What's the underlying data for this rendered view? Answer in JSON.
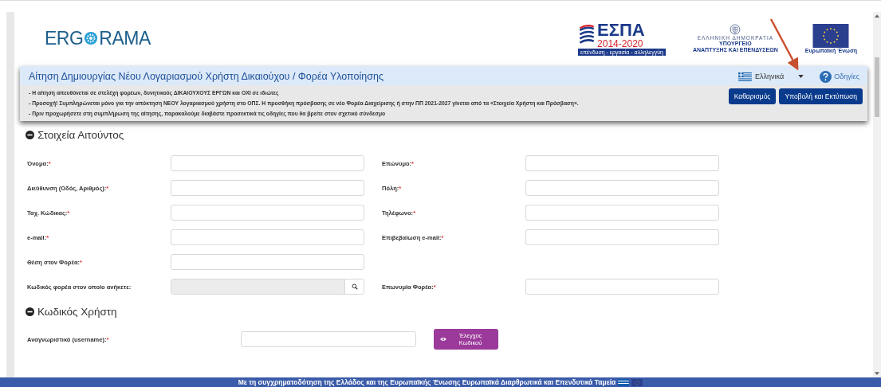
{
  "header": {
    "logo": {
      "before": "ERG",
      "after": "RAMA"
    },
    "espa": {
      "name": "ΕΣΠΑ",
      "years": "2014-2020",
      "motto": "επένδυση - εργασία - αλληλεγγύη"
    },
    "ministry": {
      "state": "ΕΛΛΗΝΙΚΗ ΔΗΜΟΚΡΑΤΙΑ",
      "line1": "ΥΠΟΥΡΓΕΙΟ",
      "line2": "ΑΝΑΠΤΥΞΗΣ ΚΑΙ ΕΠΕΝΔΥΣΕΩΝ"
    },
    "eu": {
      "name": "Ευρωπαϊκή Ένωση"
    }
  },
  "panel": {
    "title": "Αίτηση Δημιουργίας Νέου Λογαριασμού Χρήστη Δικαιούχου / Φορέα Υλοποίησης",
    "language": "Ελληνικά",
    "help": "Οδηγίες",
    "notes": [
      "- Η αίτηση απευθύνεται σε στελέχη φορέων, δυνητικούς ΔΙΚΑΙΟΥΧΟΥΣ ΕΡΓΩΝ και ΟΧΙ σε ιδιώτες",
      "- Προσοχή! Συμπληρώνεται μόνο για την απόκτηση ΝΕΟΥ λογαριασμού χρήστη στο ΟΠΣ. Η προσθήκη πρόσβασης σε νέο Φορέα Διαχείρισης ή στην ΠΠ 2021-2027 γίνεται από τα «Στοιχεία Χρήστη και Πρόσβαση».",
      "- Πριν προχωρήσετε στη συμπλήρωση της αίτησης, παρακαλούμε διαβάστε προσεκτικά τις οδηγίες που θα βρείτε στον σχετικό σύνδεσμο"
    ],
    "buttons": [
      "Καθαρισμός",
      "Υποβολή και Εκτύπωση"
    ]
  },
  "sections": [
    {
      "title": "Στοιχεία Αιτούντος",
      "expanded": true,
      "rows": [
        {
          "left": {
            "label": "Όνομα:",
            "mark": "*",
            "kind": "text"
          },
          "right": {
            "label": "Επώνυμο:",
            "mark": "*",
            "kind": "text"
          }
        },
        {
          "left": {
            "label": "Διεύθυνση (Οδός, Αριθμός):",
            "mark": "*",
            "kind": "text"
          },
          "right": {
            "label": "Πόλη:",
            "mark": "*",
            "kind": "text"
          }
        },
        {
          "left": {
            "label": "Ταχ. Κώδικας:",
            "mark": "*",
            "kind": "text"
          },
          "right": {
            "label": "Τηλέφωνο:",
            "mark": "*",
            "kind": "text"
          }
        },
        {
          "left": {
            "label": "e-mail:",
            "mark": "*",
            "kind": "text"
          },
          "right": {
            "label": "Επιβεβαίωση e-mail:",
            "mark": "*",
            "kind": "text"
          }
        },
        {
          "left": {
            "label": "Θέση στον Φορέα:",
            "mark": "*",
            "kind": "text"
          }
        },
        {
          "left": {
            "label": "Κωδικός φορέα στον οποίο ανήκετε:",
            "kind": "lookup"
          },
          "right": {
            "label": "Επωνυμία Φορέα:",
            "mark": "*",
            "kind": "text"
          }
        }
      ]
    },
    {
      "title": "Κωδικός Χρήστη",
      "expanded": true,
      "rows": [
        {
          "left": {
            "label": "Αναγνωριστικό (username):",
            "mark": "*",
            "kind": "text",
            "button": "Έλεγχος Κωδικού"
          }
        }
      ]
    }
  ],
  "footer": "Με τη συγχρηματοδότηση της Ελλάδος και της Ευρωπαϊκής Ένωσης Ευρωπαϊκά Διαρθρωτικά και Επενδυτικά Ταμεία"
}
